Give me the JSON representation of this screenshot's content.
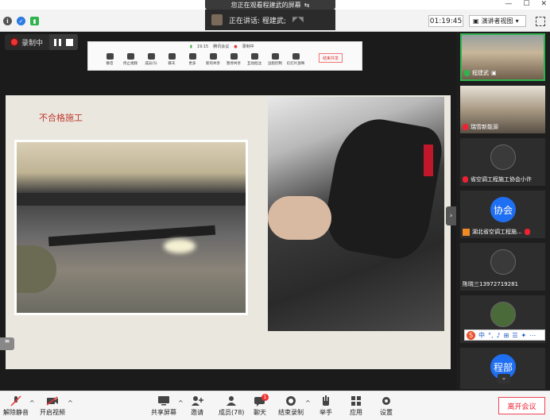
{
  "title_bar": {
    "share_notice": "您正在观看程建武的屏幕"
  },
  "top_bar": {
    "speaking_label": "正在讲话: 程建武;",
    "timer": "01:19:45",
    "view_mode": "演讲者视图"
  },
  "recording": {
    "label": "录制中"
  },
  "slide": {
    "title": "不合格施工"
  },
  "shared_toolbar": {
    "time": "19:15",
    "app": "腾讯会议",
    "rec": "录制中",
    "tools": [
      "静音",
      "停止视频",
      "成员(5)",
      "聊天",
      "更多",
      "新的共享",
      "暂停共享",
      "互动批注",
      "远程控制",
      "幻灯片放映"
    ],
    "end_label": "结束共享"
  },
  "participants": [
    {
      "name": "程建武",
      "mic": "green"
    },
    {
      "name": "瑞雪新能源",
      "mic": "red"
    },
    {
      "name": "省空调工程施工协会小许",
      "mic": "red"
    },
    {
      "name": "湖北省空调工程施...",
      "mic": "red",
      "avatar_text": "协会"
    },
    {
      "name": "陈晓三13972719281",
      "mic": "none"
    },
    {
      "name": "",
      "mic": "none"
    },
    {
      "name": "",
      "mic": "none",
      "avatar_text": "程部"
    }
  ],
  "ime_bar": {
    "items": [
      "中",
      "°,",
      "♪",
      "⊞",
      "☰",
      "✦",
      "⋯"
    ]
  },
  "bottom_bar": {
    "unmute": "解除静音",
    "start_video": "开启视频",
    "share_screen": "共享屏幕",
    "invite": "邀请",
    "members": "成员(78)",
    "chat": "聊天",
    "chat_badge": "1",
    "end_record": "结束录制",
    "raise_hand": "举手",
    "apps": "应用",
    "settings": "设置",
    "leave": "离开会议"
  },
  "colors": {
    "accent_green": "#2fb44d",
    "record_red": "#e33333",
    "avatar_blue": "#1f6ff2",
    "leave_red": "#e22233"
  }
}
